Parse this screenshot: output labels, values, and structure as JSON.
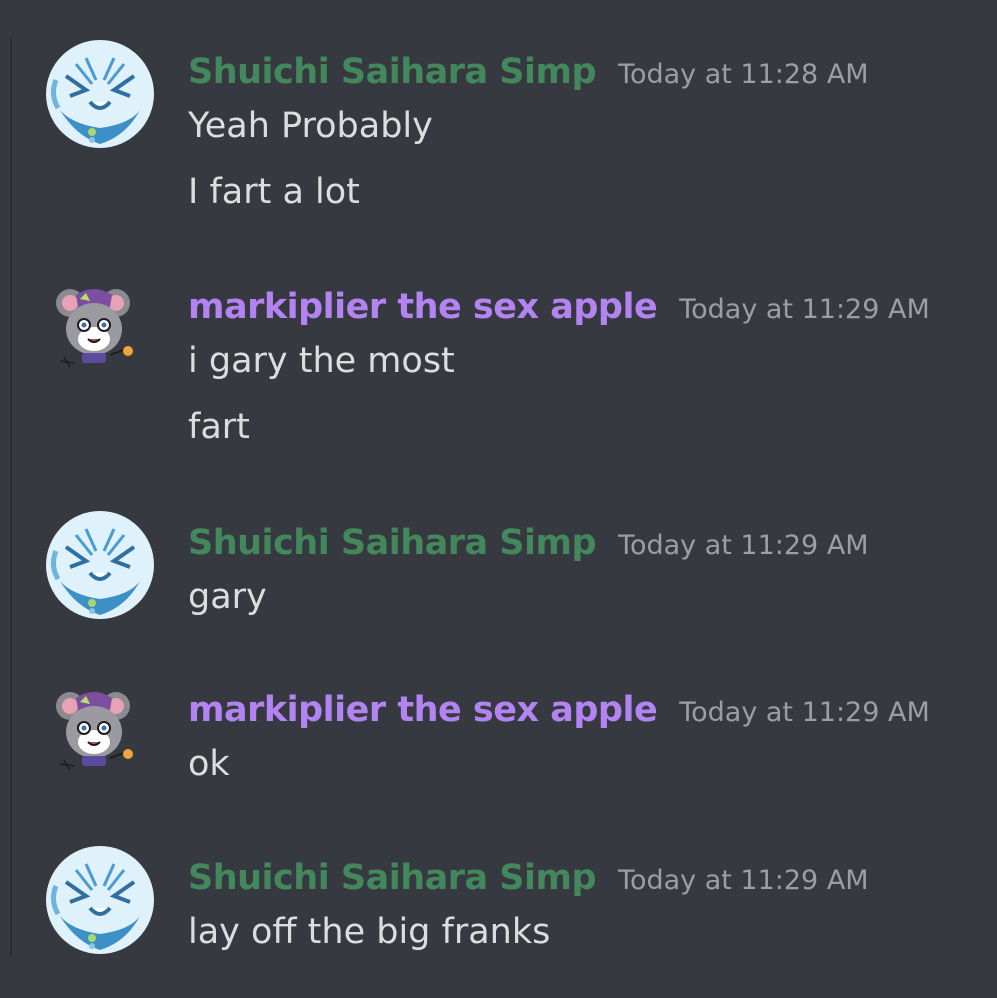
{
  "colors": {
    "background": "#36393f",
    "shuichi_name": "#43875c",
    "mark_name": "#b383f2",
    "timestamp": "#9b9ea5",
    "message_text": "#dcddde"
  },
  "messages": [
    {
      "author": "Shuichi Saihara Simp",
      "avatar_icon": "anime-avatar-icon",
      "timestamp": "Today at 11:28 AM",
      "lines": [
        "Yeah Probably",
        "I fart a lot"
      ]
    },
    {
      "author": "markiplier the sex apple",
      "avatar_icon": "mouse-avatar-icon",
      "timestamp": "Today at 11:29 AM",
      "lines": [
        "i gary the most",
        "fart"
      ]
    },
    {
      "author": "Shuichi Saihara Simp",
      "avatar_icon": "anime-avatar-icon",
      "timestamp": "Today at 11:29 AM",
      "lines": [
        "gary"
      ]
    },
    {
      "author": "markiplier the sex apple",
      "avatar_icon": "mouse-avatar-icon",
      "timestamp": "Today at 11:29 AM",
      "lines": [
        "ok"
      ]
    },
    {
      "author": "Shuichi Saihara Simp",
      "avatar_icon": "anime-avatar-icon",
      "timestamp": "Today at 11:29 AM",
      "lines": [
        "lay off the big franks"
      ]
    }
  ]
}
